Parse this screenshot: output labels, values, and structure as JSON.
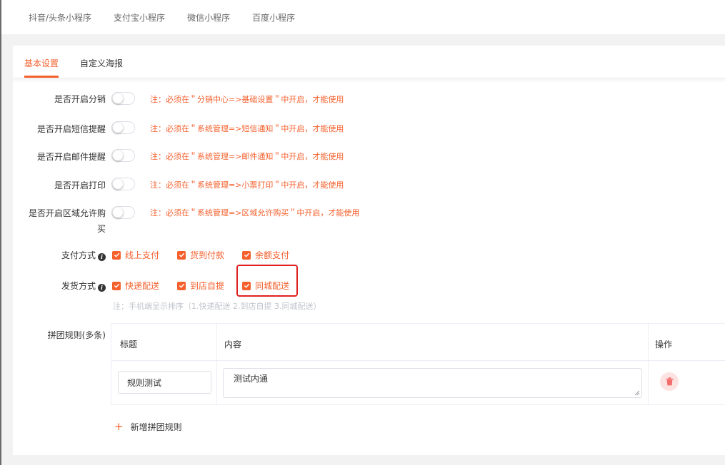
{
  "top_tabs": [
    "抖音/头条小程序",
    "支付宝小程序",
    "微信小程序",
    "百度小程序"
  ],
  "inner_tabs": {
    "basic": "基本设置",
    "poster": "自定义海报",
    "active": "basic"
  },
  "toggles": [
    {
      "label": "是否开启分销",
      "note": "注：必须在＂分销中心=>基础设置＂中开启，才能使用",
      "on": false
    },
    {
      "label": "是否开启短信提醒",
      "note": "注：必须在＂系统管理=>短信通知＂中开启，才能使用",
      "on": false
    },
    {
      "label": "是否开启邮件提醒",
      "note": "注：必须在＂系统管理=>邮件通知＂中开启，才能使用",
      "on": false
    },
    {
      "label": "是否开启打印",
      "note": "注：必须在＂系统管理=>小票打印＂中开启，才能使用",
      "on": false
    },
    {
      "label_line1": "是否开启区域允许购",
      "label_line2": "买",
      "note": "注：必须在＂系统管理=>区域允许购买＂中开启，才能使用",
      "on": false
    }
  ],
  "payment": {
    "label": "支付方式",
    "options": [
      {
        "label": "线上支付",
        "checked": true
      },
      {
        "label": "货到付款",
        "checked": true
      },
      {
        "label": "余额支付",
        "checked": true
      }
    ]
  },
  "delivery": {
    "label": "发货方式",
    "options": [
      {
        "label": "快递配送",
        "checked": true
      },
      {
        "label": "到店自提",
        "checked": true
      },
      {
        "label": "同城配送",
        "checked": true
      }
    ],
    "hint": "注：手机端显示排序（1.快递配送 2.到店自提 3.同城配送）"
  },
  "rules": {
    "label": "拼团规则(多条)",
    "columns": {
      "title": "标题",
      "content": "内容",
      "action": "操作"
    },
    "rows": [
      {
        "title": "规则测试",
        "content": "测试内通"
      }
    ],
    "add_label": "新增拼团规则"
  },
  "colors": {
    "accent": "#f5602d",
    "highlight": "#e02020",
    "delete_bg": "#fde2e2"
  }
}
